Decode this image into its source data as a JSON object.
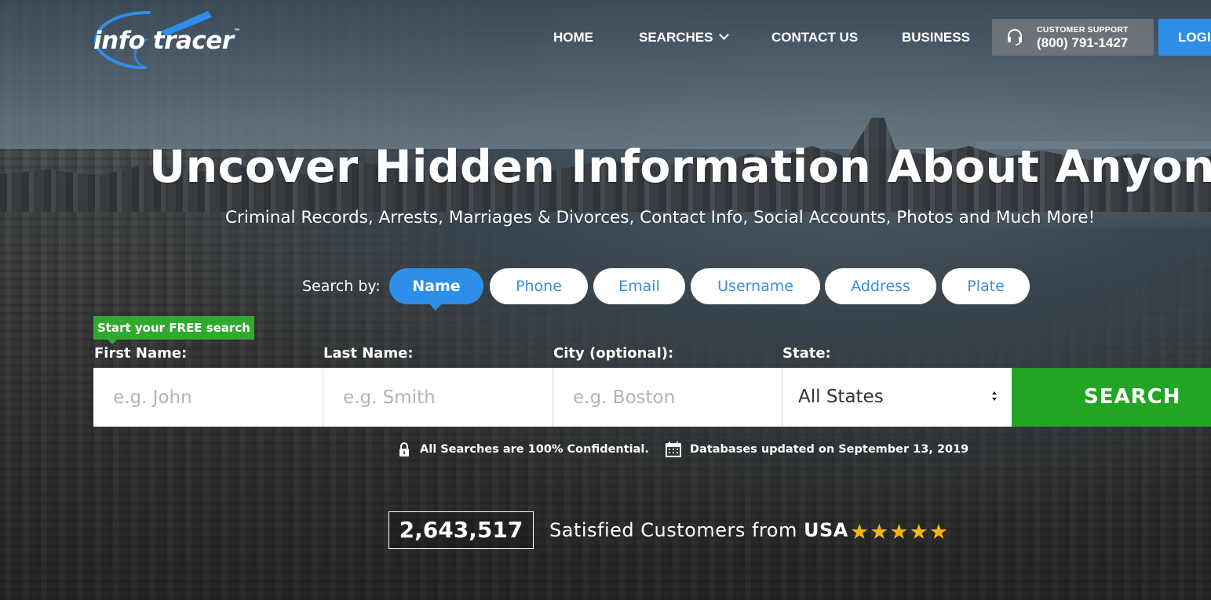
{
  "brand": {
    "logo_text": "info tracer",
    "logo_tm": "™"
  },
  "nav": {
    "home": "HOME",
    "searches": "SEARCHES",
    "contact": "CONTACT US",
    "business": "BUSINESS"
  },
  "support": {
    "label": "CUSTOMER SUPPORT",
    "phone": "(800) 791-1427",
    "icon": "headset-icon"
  },
  "login": {
    "label": "LOGIN"
  },
  "hero": {
    "title": "Uncover Hidden Information About Anyone",
    "subtitle": "Criminal Records, Arrests, Marriages & Divorces, Contact Info, Social Accounts, Photos and Much More!"
  },
  "search_by": {
    "label": "Search by:",
    "tabs": [
      {
        "label": "Name",
        "active": true
      },
      {
        "label": "Phone",
        "active": false
      },
      {
        "label": "Email",
        "active": false
      },
      {
        "label": "Username",
        "active": false
      },
      {
        "label": "Address",
        "active": false
      },
      {
        "label": "Plate",
        "active": false
      }
    ]
  },
  "form": {
    "badge": "Start your FREE search",
    "first_name": {
      "label": "First Name:",
      "placeholder": "e.g. John",
      "value": ""
    },
    "last_name": {
      "label": "Last Name:",
      "placeholder": "e.g. Smith",
      "value": ""
    },
    "city": {
      "label": "City (optional):",
      "placeholder": "e.g. Boston",
      "value": ""
    },
    "state": {
      "label": "State:",
      "selected": "All States"
    },
    "search_button": "SEARCH"
  },
  "notes": {
    "confidential": "All Searches are 100% Confidential.",
    "updated": "Databases updated on September 13, 2019"
  },
  "stats": {
    "count": "2,643,517",
    "text": "Satisfied Customers from ",
    "country": "USA",
    "rating_stars": "★★★★★"
  },
  "colors": {
    "accent_blue": "#2f8fe8",
    "search_green": "#22a522",
    "star_gold": "#f7b512"
  }
}
